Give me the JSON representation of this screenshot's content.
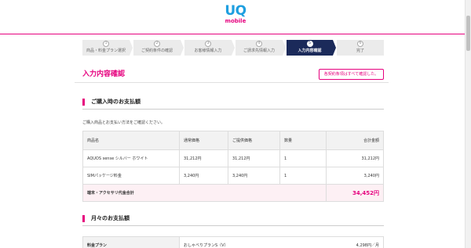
{
  "header": {
    "logo_uq": "UQ",
    "logo_mobile": "mobile"
  },
  "steps": [
    {
      "num": "1",
      "label": "商品・料金プラン選択",
      "active": false
    },
    {
      "num": "2",
      "label": "ご契約条件の確認",
      "active": false
    },
    {
      "num": "3",
      "label": "お客様情報入力",
      "active": false
    },
    {
      "num": "4",
      "label": "ご請求先情報入力",
      "active": false
    },
    {
      "num": "5",
      "label": "入力内容確認",
      "active": true
    },
    {
      "num": "6",
      "label": "完了",
      "active": false
    }
  ],
  "page": {
    "title": "入力内容確認",
    "terms_button": "各契約条項はすべて確認した。"
  },
  "purchase": {
    "section_title": "ご購入時のお支払額",
    "note": "ご購入商品とお支払い方法をご確認ください。",
    "columns": [
      "商品名",
      "通常価格",
      "ご提供価格",
      "数量",
      "合計金額"
    ],
    "rows": [
      {
        "name": "AQUOS sense シルバー ホワイト",
        "regular": "31,212円",
        "offer": "31,212円",
        "qty": "1",
        "total": "31,212円"
      },
      {
        "name": "SIMパッケージ料金",
        "regular": "3,240円",
        "offer": "3,240円",
        "qty": "1",
        "total": "3,240円"
      }
    ],
    "total_label": "端末・アクセサリ代金合計",
    "total_value": "34,452円"
  },
  "monthly": {
    "section_title": "月々のお支払額",
    "rows": [
      {
        "head": "料金プラン",
        "value": "おしゃべりプランS（V）",
        "amount": "4,298円／月"
      }
    ]
  },
  "colors": {
    "accent": "#e6007e",
    "logo_blue": "#1e9fe0",
    "active_step": "#1b2a5a"
  }
}
